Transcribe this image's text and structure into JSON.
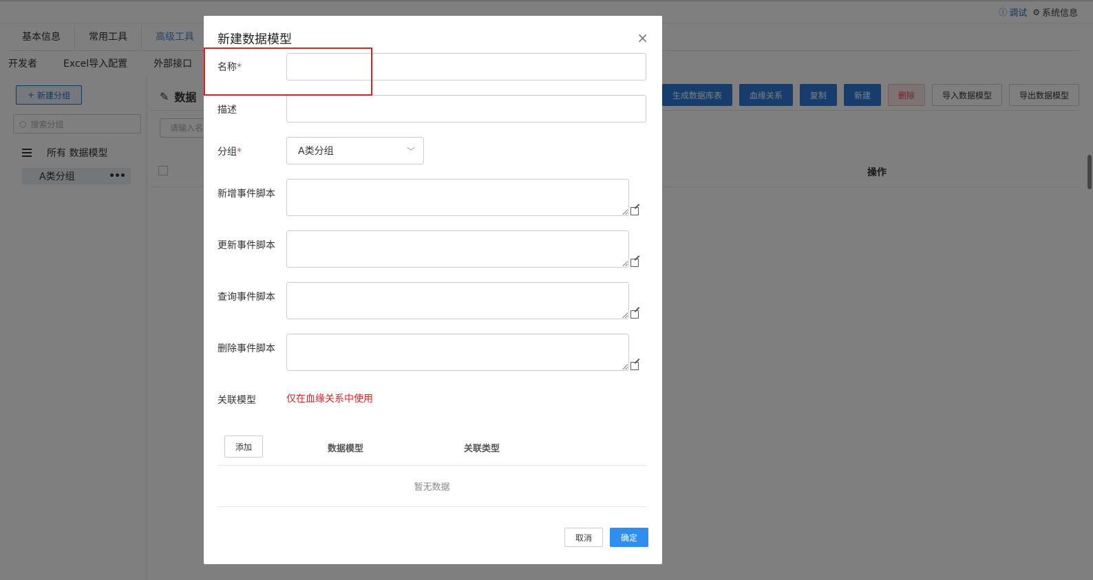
{
  "topbar": {
    "debug_label": "调试",
    "sysinfo_label": "系统信息",
    "debug_icon": "info-circle-icon",
    "sysinfo_icon": "gear-icon"
  },
  "tabs_main": [
    "基本信息",
    "常用工具",
    "高级工具"
  ],
  "tabs_main_active": 2,
  "tabs_sub": [
    "开发者",
    "Excel导入配置",
    "外部接口"
  ],
  "sidebar": {
    "new_group_label": "新建分组",
    "search_placeholder": "搜索分组",
    "all_models_label": "所有 数据模型",
    "group_item_label": "A类分组",
    "group_item_more": "•••"
  },
  "main": {
    "title": "数据",
    "search_placeholder": "请输入名",
    "toolbar": [
      "生成数据库表",
      "血缘关系",
      "复制",
      "新建",
      "删除",
      "导入数据模型",
      "导出数据模型"
    ],
    "table_header_op": "操作"
  },
  "modal": {
    "title": "新建数据模型",
    "close": "×",
    "name_label": "名称",
    "required_mark": "*",
    "desc_label": "描述",
    "group_label": "分组",
    "group_value": "A类分组",
    "group_chevron": "﹀",
    "script_labels": [
      "新增事件脚本",
      "更新事件脚本",
      "查询事件脚本",
      "删除事件脚本"
    ],
    "relation_label": "关联模型",
    "relation_note": "仅在血缘关系中使用",
    "add_button": "添加",
    "col_model": "数据模型",
    "col_relation_type": "关联类型",
    "empty_text": "暂无数据",
    "cancel": "取消",
    "ok": "确定"
  },
  "colors": {
    "primary": "#2d7ad6",
    "danger": "#e64444",
    "highlight": "#e02020"
  }
}
